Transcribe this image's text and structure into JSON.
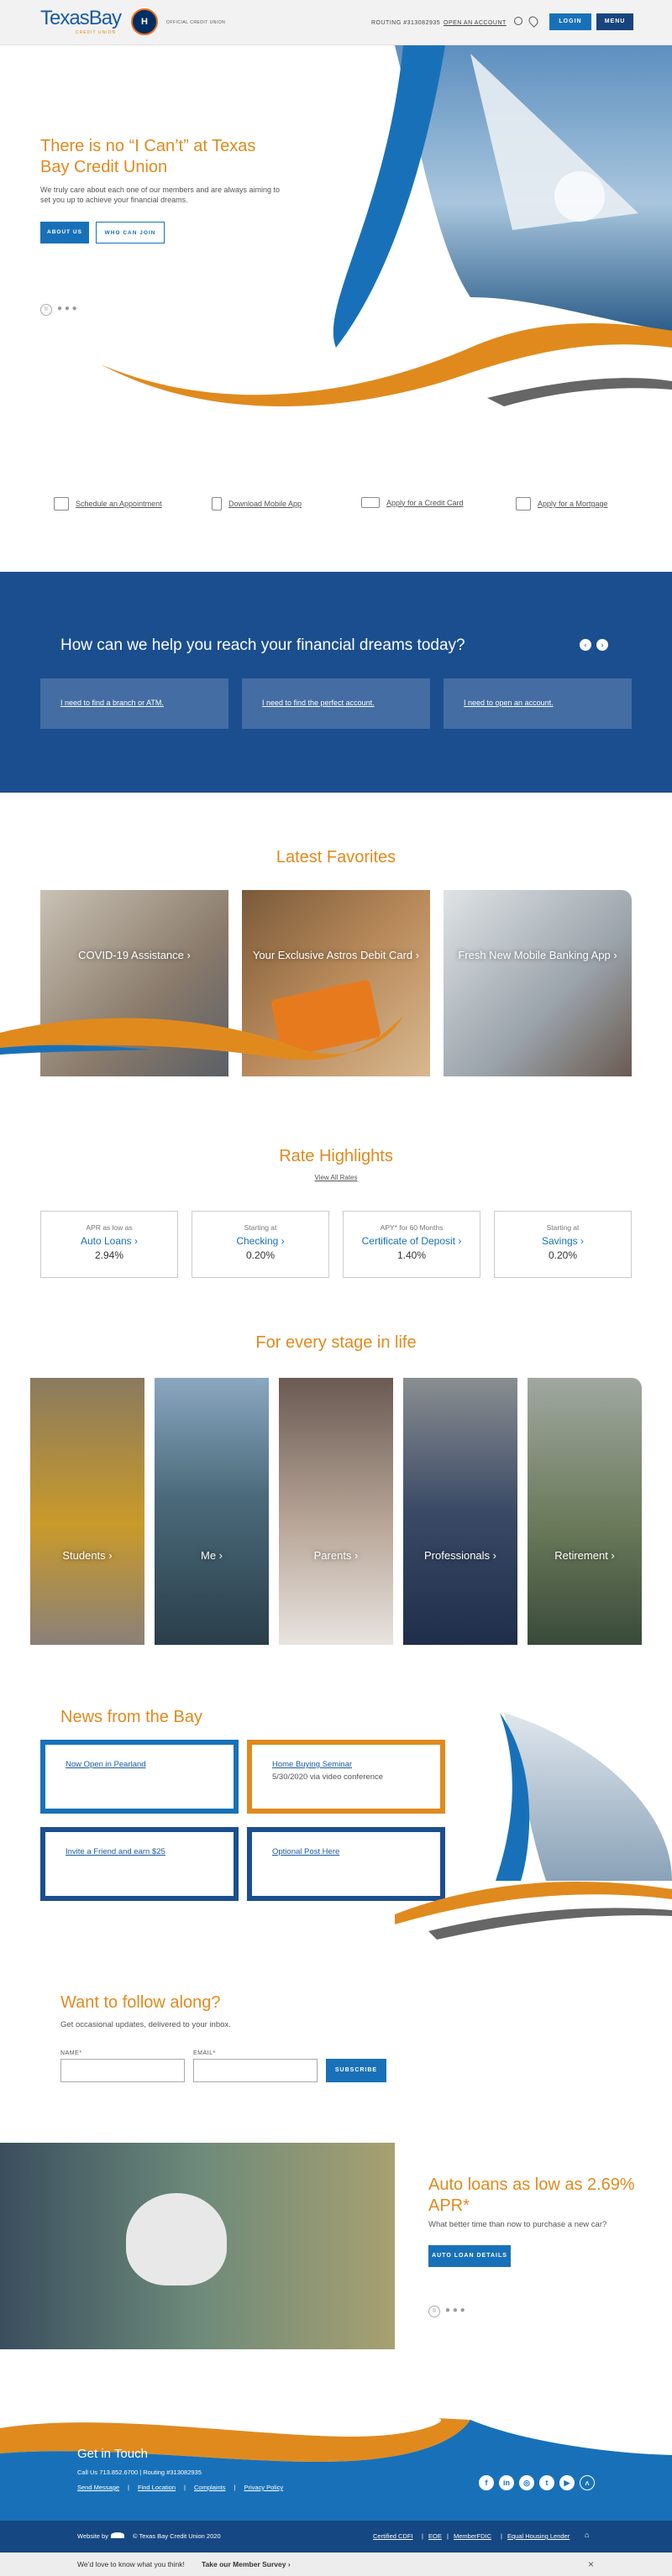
{
  "header": {
    "logo_text": "TexasBay",
    "logo_sub": "CREDIT UNION",
    "badge_text": "H",
    "official_text": "OFFICIAL CREDIT UNION",
    "routing_label": "ROUTING #313082935",
    "open_account_label": "OPEN AN ACCOUNT",
    "login_label": "LOGIN",
    "menu_label": "MENU"
  },
  "hero": {
    "title": "There is no “I Can’t” at Texas Bay Credit Union",
    "text": "We truly care about each one of our members and are always aiming to set you up to achieve your financial dreams.",
    "about_label": "ABOUT US",
    "join_label": "WHO CAN JOIN"
  },
  "quicklinks": [
    {
      "label": "Schedule an Appointment",
      "icon": "calendar-icon"
    },
    {
      "label": "Download Mobile App",
      "icon": "mobile-icon"
    },
    {
      "label": "Apply for a Credit Card",
      "icon": "credit-card-icon"
    },
    {
      "label": "Apply for a Mortgage",
      "icon": "house-icon"
    }
  ],
  "band": {
    "title": "How can we help you reach your financial dreams today?",
    "options": [
      "I need to find a branch or ATM.",
      "I need to find the perfect account.",
      "I need to open an account."
    ]
  },
  "favorites": {
    "title": "Latest Favorites",
    "items": [
      "COVID-19 Assistance ›",
      "Your Exclusive Astros Debit Card ›",
      "Fresh New Mobile Banking App ›"
    ]
  },
  "rates": {
    "title": "Rate Highlights",
    "view_all": "View All Rates",
    "items": [
      {
        "top": "APR as low as",
        "product": "Auto Loans ›",
        "value": "2.94%"
      },
      {
        "top": "Starting at",
        "product": "Checking ›",
        "value": "0.20%"
      },
      {
        "top": "APY* for 60 Months",
        "product": "Certificate of Deposit ›",
        "value": "1.40%"
      },
      {
        "top": "Starting at",
        "product": "Savings ›",
        "value": "0.20%"
      }
    ]
  },
  "stages": {
    "title": "For every stage in life",
    "items": [
      "Students ›",
      "Me ›",
      "Parents ›",
      "Professionals ›",
      "Retirement ›"
    ]
  },
  "news": {
    "title": "News from the Bay",
    "items": [
      {
        "link": "Now Open in Pearland",
        "sub": ""
      },
      {
        "link": "Home Buying Seminar",
        "sub": "5/30/2020 via video conference"
      },
      {
        "link": "Invite a Friend and earn $25",
        "sub": ""
      },
      {
        "link": "Optional Post Here",
        "sub": ""
      }
    ]
  },
  "follow": {
    "title": "Want to follow along?",
    "sub": "Get occasional updates, delivered to your inbox.",
    "name_label": "NAME*",
    "email_label": "EMAIL*",
    "subscribe_label": "SUBSCRIBE"
  },
  "promo": {
    "title": "Auto loans as low as 2.69% APR*",
    "text": "What better time than now to purchase a new car?",
    "button": "AUTO LOAN DETAILS"
  },
  "footer": {
    "title": "Get in Touch",
    "contact": "Call Us 713.852.6700   |   Routing #313082935",
    "links": [
      "Send Message",
      "Find Location",
      "Complaints",
      "Privacy Policy"
    ],
    "website_by": "Website by",
    "copyright": "© Texas Bay Credit Union 2020",
    "legal": [
      "Certified CDFI",
      "EOE",
      "MemberFDIC",
      "Equal Housing Lender"
    ],
    "survey_text": "We’d love to know what you think!",
    "survey_link": "Take our Member Survey ›"
  },
  "colors": {
    "orange": "#e08a1e",
    "blue": "#1871b8",
    "navy": "#1b4e8f"
  }
}
